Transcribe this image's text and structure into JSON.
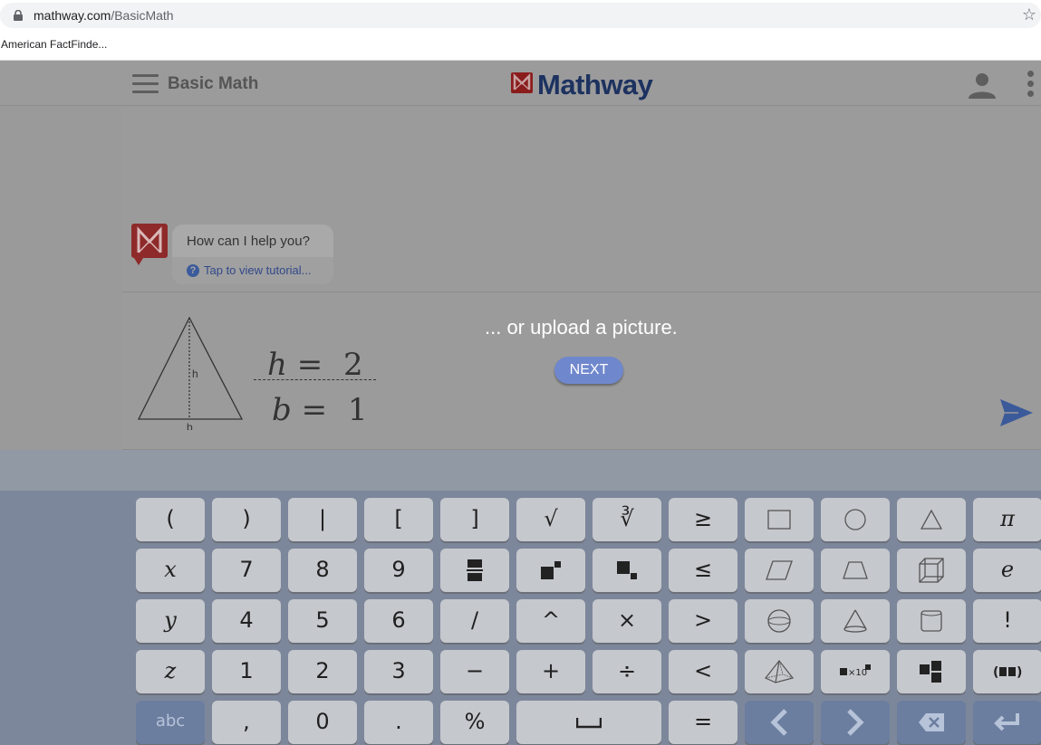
{
  "browser": {
    "url_domain": "mathway.com",
    "url_path": "/BasicMath",
    "bookmarks": [
      "American FactFinde..."
    ]
  },
  "header": {
    "subject": "Basic Math",
    "logo_text": "Mathway"
  },
  "chat": {
    "greeting": "How can I help you?",
    "tutorial_link": "Tap to view tutorial...",
    "help_icon": "?"
  },
  "tutorial": {
    "upload_text": "... or upload a picture.",
    "next_label": "NEXT",
    "triangle": {
      "h_label": "h",
      "b_label": "b"
    },
    "formula": {
      "h_var": "h",
      "h_value": "2",
      "b_var": "b",
      "b_value": "1",
      "equals": "="
    }
  },
  "keypad": {
    "rows": [
      [
        "(",
        ")",
        "|",
        "[",
        "]",
        "√",
        "∛",
        "≥",
        "square-icon",
        "circle-icon",
        "triangle-icon",
        "π"
      ],
      [
        "x",
        "7",
        "8",
        "9",
        "fraction-icon",
        "superscript-icon",
        "subscript-icon",
        "≤",
        "parallelogram-icon",
        "trapezoid-icon",
        "cube-icon",
        "e"
      ],
      [
        "y",
        "4",
        "5",
        "6",
        "/",
        "^",
        "×",
        ">",
        "sphere-icon",
        "cone-icon",
        "cylinder-icon",
        "!"
      ],
      [
        "z",
        "1",
        "2",
        "3",
        "−",
        "+",
        "÷",
        "<",
        "pyramid-icon",
        "scientific-notation-icon",
        "matrix-icon",
        "interval-icon"
      ],
      [
        "abc",
        ",",
        "0",
        ".",
        "%",
        "space-icon",
        "=",
        "left-arrow-icon",
        "right-arrow-icon",
        "backspace-icon",
        "enter-icon"
      ]
    ],
    "sci_label": "×10"
  }
}
